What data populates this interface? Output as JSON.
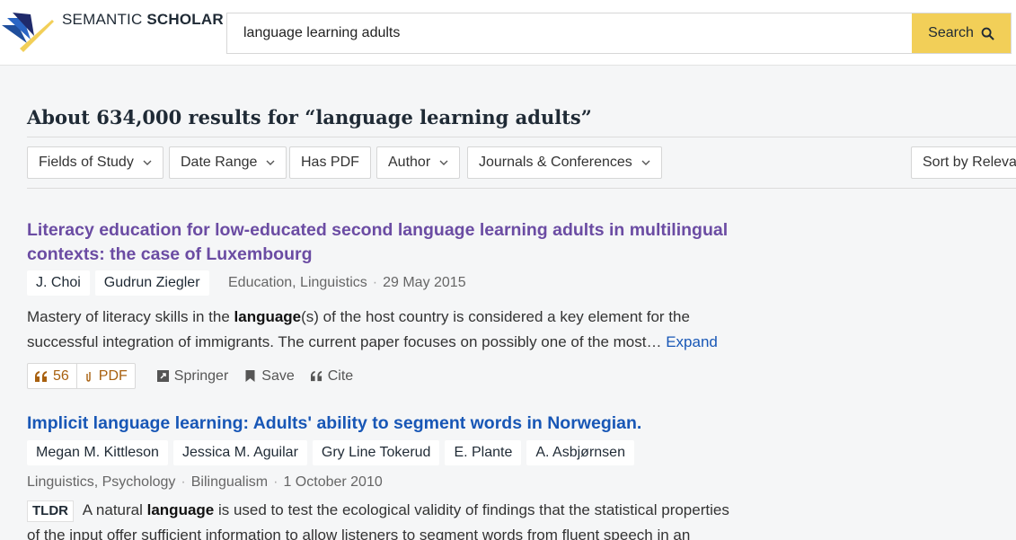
{
  "header": {
    "logo_light": "SEMANTIC",
    "logo_bold": "SCHOLAR",
    "search_value": "language learning adults",
    "search_button": "Search"
  },
  "results": {
    "heading": "About 634,000 results for “language learning adults”"
  },
  "filters": {
    "fields_of_study": "Fields of Study",
    "date_range": "Date Range",
    "has_pdf": "Has PDF",
    "author": "Author",
    "journals": "Journals & Conferences",
    "sort": "Sort by Relevance"
  },
  "papers": [
    {
      "title_line1": "Literacy education for low-educated second language learning adults in multilingual",
      "title_line2": "contexts: the case of Luxembourg",
      "authors": [
        "J. Choi",
        "Gudrun Ziegler"
      ],
      "fields": "Education, Linguistics",
      "date": "29 May 2015",
      "abstract_line1_pre": "Mastery of literacy skills in the ",
      "abstract_line1_bold": "language",
      "abstract_line1_post": "(s) of the host country is considered a key element for the",
      "abstract_line2": "successful integration of immigrants. The current paper focuses on possibly one of the most…",
      "expand": "Expand",
      "citations": "56",
      "pdf": "PDF",
      "publisher": "Springer",
      "save": "Save",
      "cite": "Cite"
    },
    {
      "title": "Implicit language learning: Adults' ability to segment words in Norwegian.",
      "authors": [
        "Megan M. Kittleson",
        "Jessica M. Aguilar",
        "Gry Line Tokerud",
        "E. Plante",
        "A. Asbjørnsen"
      ],
      "fields": "Linguistics, Psychology",
      "venue": "Bilingualism",
      "date": "1 October 2010",
      "tldr": "TLDR",
      "tldr_pre": " A natural ",
      "tldr_bold": "language",
      "tldr_post": " is used to test the ecological validity of findings that the statistical properties",
      "tldr_line2": "of the input offer sufficient information to allow listeners to segment words from fluent speech in an"
    }
  ],
  "colors": {
    "search_button": "#f2cf58",
    "visited_title": "#6b4ca3",
    "link_title": "#1857b6",
    "citation_accent": "#a8600f"
  },
  "icons": [
    "book-logo-icon",
    "search-icon",
    "chevron-down-icon",
    "quote-icon",
    "pdf-icon",
    "external-link-icon",
    "bookmark-icon"
  ]
}
